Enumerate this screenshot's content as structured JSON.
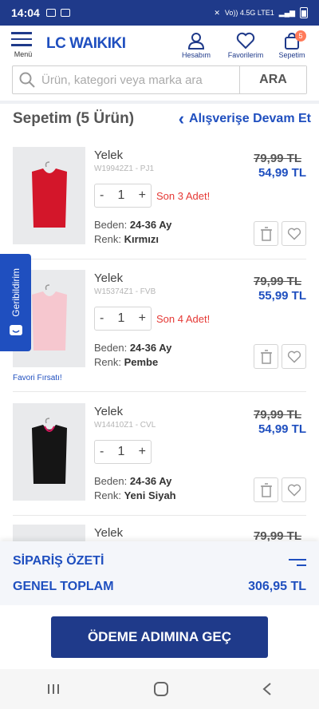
{
  "status": {
    "time": "14:04",
    "net_label": "Vo)) 4.5G LTE1"
  },
  "header": {
    "menu_label": "Menü",
    "logo": "LC WAIKIKI",
    "account_label": "Hesabım",
    "favorites_label": "Favorilerim",
    "cart_label": "Sepetim",
    "cart_count": "5"
  },
  "search": {
    "placeholder": "Ürün, kategori veya marka ara",
    "button": "ARA"
  },
  "cart": {
    "title": "Sepetim (5 Ürün)",
    "continue_label": "Alışverişe Devam Et"
  },
  "items": [
    {
      "name": "Yelek",
      "sku": "W19942Z1 - PJ1",
      "old_price": "79,99 TL",
      "new_price": "54,99 TL",
      "qty": "1",
      "stock": "Son 3 Adet!",
      "size_label": "Beden:",
      "size": "24-36 Ay",
      "color_label": "Renk:",
      "color": "Kırmızı",
      "swatch": "#d3162a"
    },
    {
      "name": "Yelek",
      "sku": "W15374Z1 - FVB",
      "old_price": "79,99 TL",
      "new_price": "55,99 TL",
      "qty": "1",
      "stock": "Son 4 Adet!",
      "size_label": "Beden:",
      "size": "24-36 Ay",
      "color_label": "Renk:",
      "color": "Pembe",
      "swatch": "#f6c7cf",
      "tag": "Favori Fırsatı!"
    },
    {
      "name": "Yelek",
      "sku": "W14410Z1 - CVL",
      "old_price": "79,99 TL",
      "new_price": "54,99 TL",
      "qty": "1",
      "size_label": "Beden:",
      "size": "24-36 Ay",
      "color_label": "Renk:",
      "color": "Yeni Siyah",
      "swatch": "#151515"
    },
    {
      "name": "Yelek",
      "old_price": "79,99 TL"
    }
  ],
  "feedback": {
    "label": "Geribildirim"
  },
  "summary": {
    "title": "SİPARİŞ ÖZETİ",
    "total_label": "GENEL TOPLAM",
    "total_value": "306,95 TL"
  },
  "checkout": {
    "label": "ÖDEME ADIMINA GEÇ"
  },
  "colors": {
    "brand": "#1f3a8a",
    "accent": "#1f4fbf",
    "alert": "#e53935"
  }
}
